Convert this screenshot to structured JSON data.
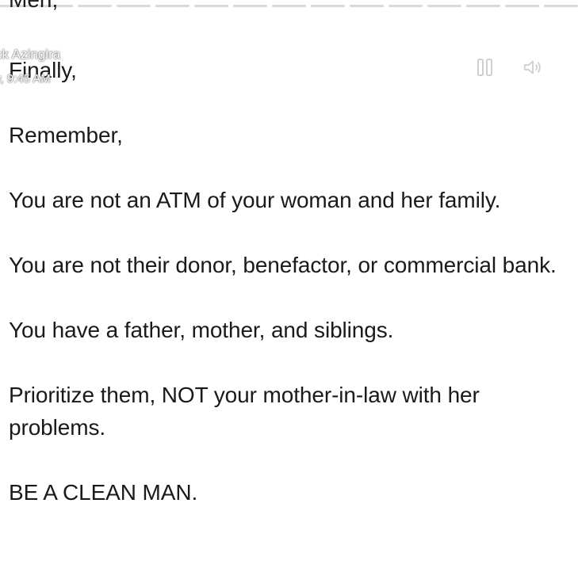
{
  "story": {
    "progress_segments": 15,
    "author_name": "ck Azingira",
    "post_time": "y, 9:45 AM"
  },
  "post": {
    "clipped_line": "Men,",
    "paragraphs": [
      "Finally,",
      "Remember,",
      "You are not an ATM of your woman and her family.",
      "You are not their donor, benefactor, or commercial bank.",
      "You have a father, mother, and siblings.",
      "Prioritize them, NOT your mother-in-law with her problems.",
      "BE A CLEAN MAN."
    ]
  },
  "controls": {
    "pause_icon": "pause-icon",
    "volume_icon": "volume-icon"
  }
}
